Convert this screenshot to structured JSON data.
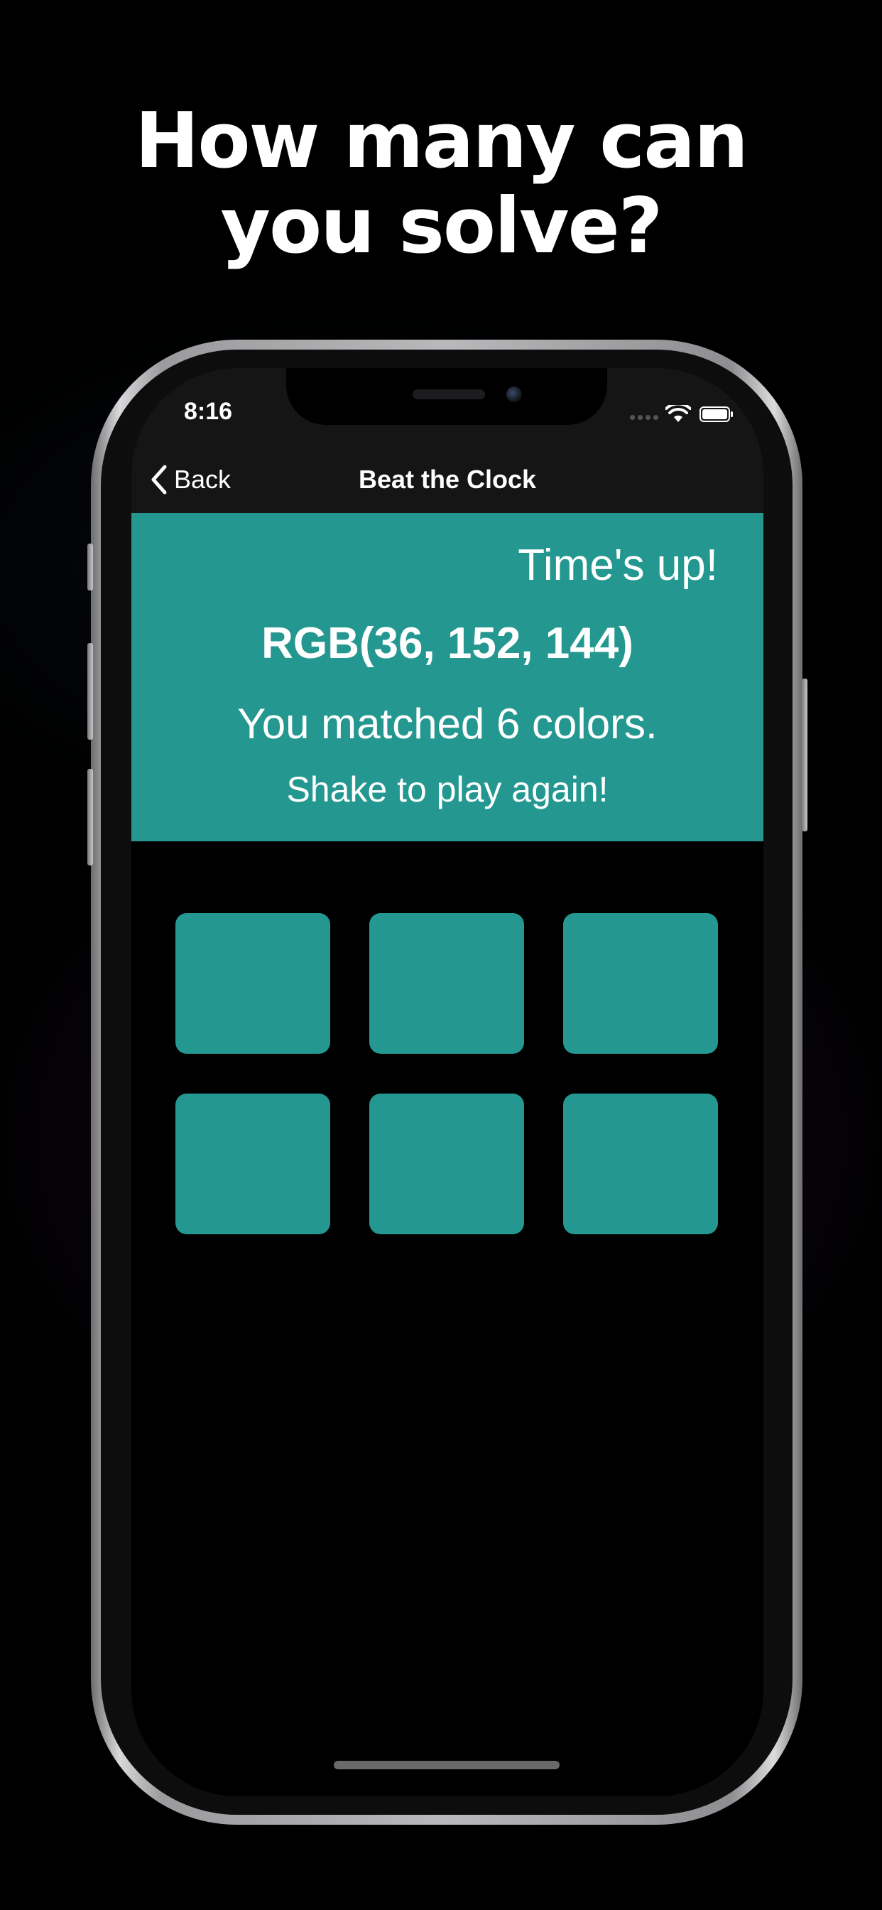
{
  "headline": {
    "line1": "How many can",
    "line2": "you solve?"
  },
  "status_bar": {
    "time": "8:16"
  },
  "nav": {
    "back_label": "Back",
    "title": "Beat the Clock"
  },
  "result": {
    "times_up": "Time's up!",
    "rgb": "RGB(36, 152, 144)",
    "matched": "You matched 6 colors.",
    "shake": "Shake to play again!",
    "color": "#249890"
  },
  "swatches": [
    {
      "color": "#249890"
    },
    {
      "color": "#249890"
    },
    {
      "color": "#249890"
    },
    {
      "color": "#249890"
    },
    {
      "color": "#249890"
    },
    {
      "color": "#249890"
    }
  ],
  "icons": {
    "back": "chevron-left-icon",
    "wifi": "wifi-icon",
    "battery": "battery-icon",
    "cellular": "cellular-signal-icon"
  }
}
